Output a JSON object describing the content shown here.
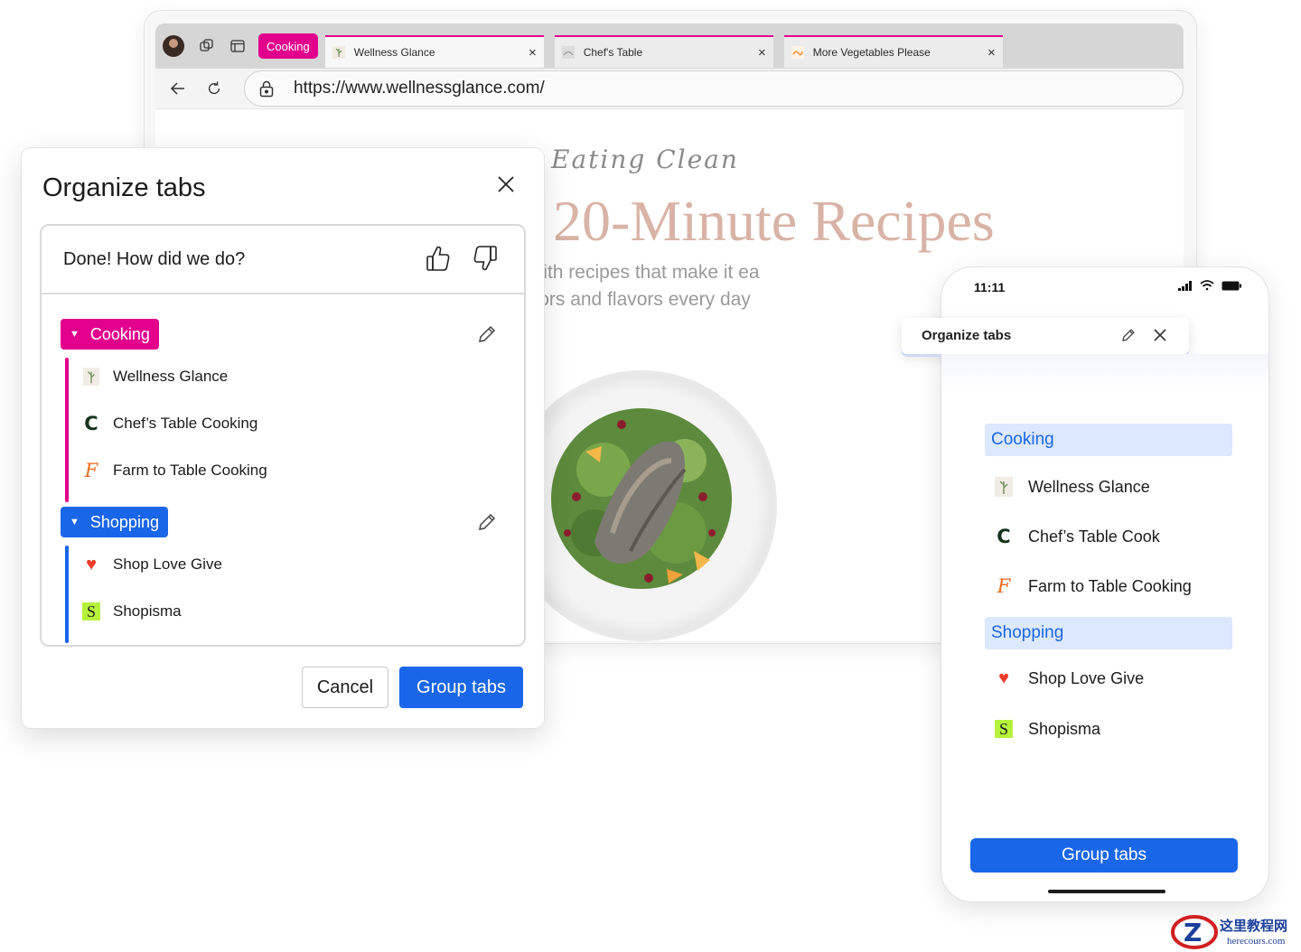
{
  "browser": {
    "group_chip": "Cooking",
    "tabs": [
      {
        "title": "Wellness Glance"
      },
      {
        "title": "Chef's Table"
      },
      {
        "title": "More Vegetables Please"
      }
    ],
    "close_glyph": "×",
    "url": "https://www.wellnessglance.com/"
  },
  "page": {
    "script_title": "Eating Clean",
    "headline": "20-Minute Recipes",
    "tagline_1": "esh and healthy with recipes that make it ea",
    "tagline_2": "of colors and flavors every day"
  },
  "dialog": {
    "title": "Organize tabs",
    "feedback_prompt": "Done! How did we do?",
    "groups": [
      {
        "name": "Cooking",
        "color": "#e3008c",
        "items": [
          {
            "label": "Wellness Glance",
            "icon": "wellness-favicon"
          },
          {
            "label": "Chef’s Table Cooking",
            "icon": "letter-c-favicon"
          },
          {
            "label": "Farm to Table Cooking",
            "icon": "letter-f-favicon"
          }
        ]
      },
      {
        "name": "Shopping",
        "color": "#1a66e8",
        "items": [
          {
            "label": "Shop Love Give",
            "icon": "heart-favicon"
          },
          {
            "label": "Shopisma",
            "icon": "letter-s-favicon"
          }
        ]
      }
    ],
    "cancel_label": "Cancel",
    "group_tabs_label": "Group tabs"
  },
  "phone": {
    "time": "11:11",
    "popup_title": "Organize tabs",
    "groups": [
      {
        "name": "Cooking",
        "items": [
          {
            "label": "Wellness Glance"
          },
          {
            "label": "Chef’s Table Cook"
          },
          {
            "label": "Farm to Table Cooking"
          }
        ]
      },
      {
        "name": "Shopping",
        "items": [
          {
            "label": "Shop Love Give"
          },
          {
            "label": "Shopisma"
          }
        ]
      }
    ],
    "group_tabs_label": "Group tabs"
  },
  "icons": {
    "c_glyph": "C",
    "f_glyph": "F",
    "s_glyph": "S",
    "heart_glyph": "♥",
    "caret_glyph": "▼"
  },
  "watermark": {
    "line1": "这里教程网",
    "line2": "herecours.com"
  }
}
